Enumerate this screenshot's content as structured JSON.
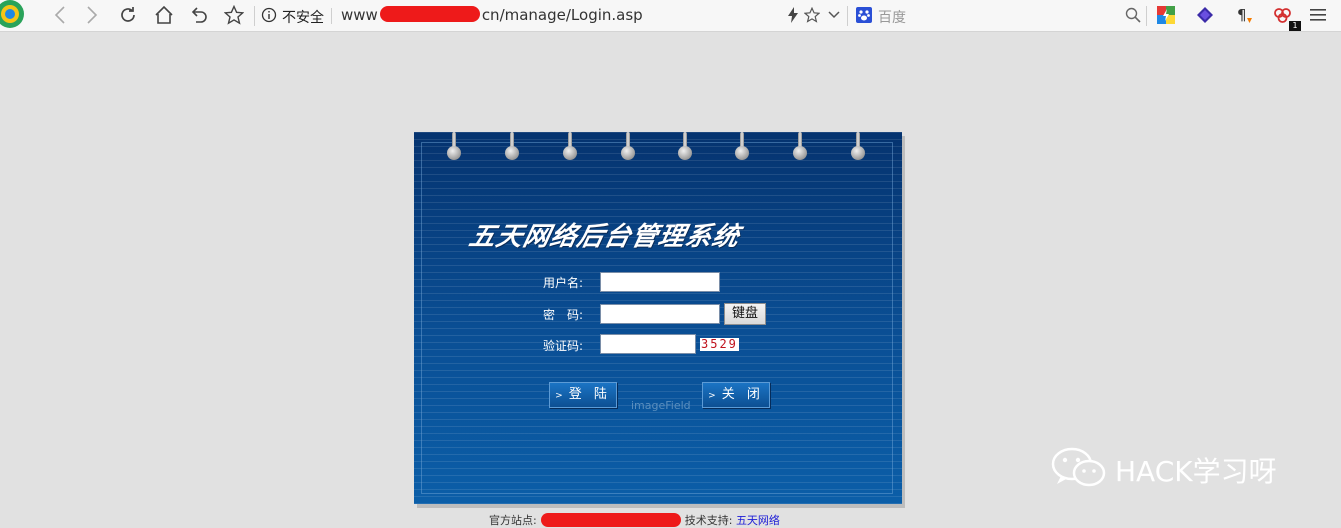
{
  "browser": {
    "security_label": "不安全",
    "url_prefix": "www",
    "url_suffix": "cn/manage/Login.asp",
    "search_engine_placeholder": "百度",
    "extension_badge": "1"
  },
  "login": {
    "system_title": "五天网络后台管理系统",
    "username_label": "用户名:",
    "username_value": "",
    "password_label": "密　码:",
    "password_value": "",
    "keyboard_button": "键盘",
    "captcha_label": "验证码:",
    "captcha_value": "",
    "captcha_code": "3529",
    "login_button": "登 陆",
    "close_button": "关 闭",
    "image_field_alt": "imageField"
  },
  "footer": {
    "official_site_label": "官方站点:",
    "tech_support_label": "技术支持:",
    "tech_support_link": "五天网络"
  },
  "watermark": {
    "text": "HACK学习呀"
  },
  "colors": {
    "panel_top": "#05336f",
    "panel_bottom": "#0b5ea8",
    "redaction": "#ee1a1a",
    "captcha_text": "#c0121c",
    "link": "#1b1bd6"
  }
}
